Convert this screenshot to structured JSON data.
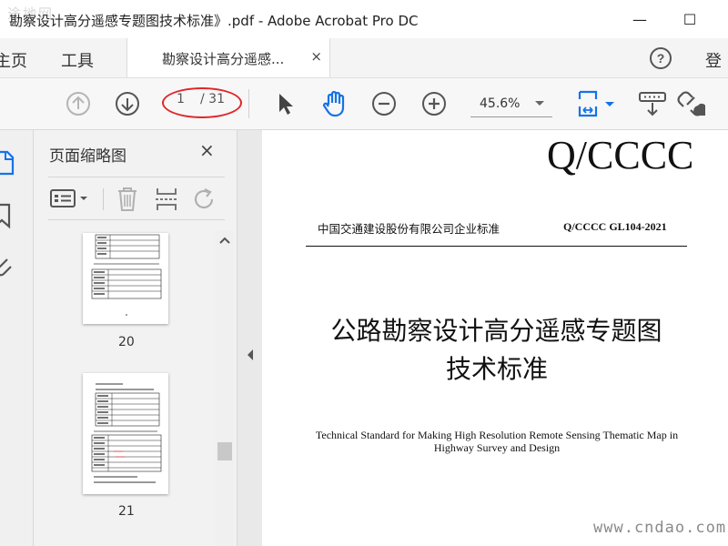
{
  "window": {
    "title": "勘察设计高分遥感专题图技术标准》.pdf - Adobe Acrobat Pro DC",
    "watermark": "途地网",
    "minimize": "—",
    "maximize": "☐"
  },
  "tabs": {
    "home": "主页",
    "tools": "工具",
    "document": "勘察设计高分遥感...",
    "close": "×",
    "help": "?",
    "login": "登"
  },
  "toolbar": {
    "page_current": "1",
    "page_total": "/ 31",
    "zoom": "45.6%",
    "icons": [
      "prev-page-icon",
      "next-page-icon",
      "select-arrow-icon",
      "hand-icon",
      "zoom-out-icon",
      "zoom-in-icon",
      "fit-page-icon",
      "keyboard-icon",
      "share-link-icon"
    ]
  },
  "panel": {
    "title": "页面缩略图",
    "close": "×",
    "thumbnails": [
      {
        "page": "20"
      },
      {
        "page": "21"
      }
    ]
  },
  "document": {
    "std_mark": "Q/CCCC",
    "organization": "中国交通建设股份有限公司企业标准",
    "std_code": "Q/CCCC GL104-2021",
    "title_cn_1": "公路勘察设计高分遥感专题图",
    "title_cn_2": "技术标准",
    "title_en": "Technical Standard for Making High Resolution Remote Sensing Thematic Map in Highway Survey and Design"
  },
  "site_watermark": "www.cndao.com",
  "colors": {
    "frame": "#f6ea1d",
    "annotation": "#e0262a",
    "accent": "#1473e6"
  }
}
